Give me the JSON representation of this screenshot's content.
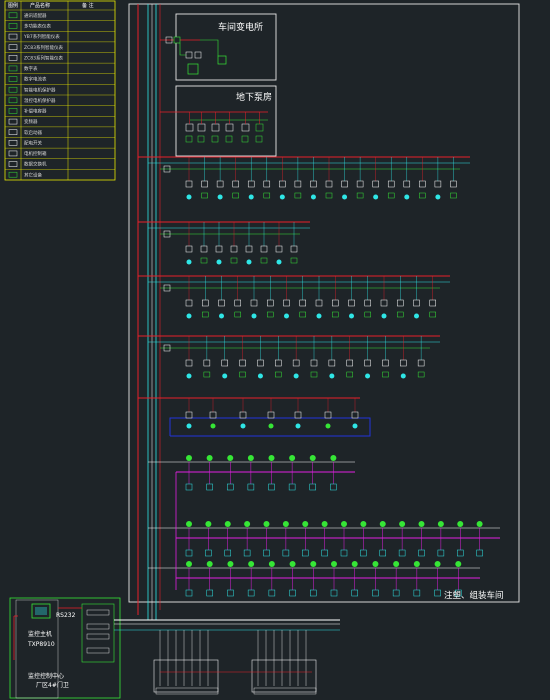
{
  "legend": {
    "headers": [
      "图例",
      "产品名称",
      "备  注"
    ],
    "items": [
      {
        "icon": "green-box-icon",
        "label": "通讯适配器"
      },
      {
        "icon": "green-box-icon",
        "label": "多功能表仪表"
      },
      {
        "icon": "small-box-icon",
        "label": "YB7系列智能仪表"
      },
      {
        "icon": "small-box-icon",
        "label": "ZC83系列智能仪表"
      },
      {
        "icon": "small-box-icon",
        "label": "ZC83系列智能仪表"
      },
      {
        "icon": "green-box-icon",
        "label": "数字表"
      },
      {
        "icon": "green-box-icon",
        "label": "数字电流表"
      },
      {
        "icon": "green-box-icon",
        "label": "智能电机保护器"
      },
      {
        "icon": "green-box-icon",
        "label": "温控电机保护器"
      },
      {
        "icon": "green-box-icon",
        "label": "补偿电容器"
      },
      {
        "icon": "box-icon",
        "label": "变频器"
      },
      {
        "icon": "box-icon",
        "label": "软启动器"
      },
      {
        "icon": "box-icon",
        "label": "配电开关"
      },
      {
        "icon": "box-icon",
        "label": "电机控制箱"
      },
      {
        "icon": "network-icon",
        "label": "数据交换机"
      },
      {
        "icon": "green-box-icon",
        "label": "其它设备"
      }
    ]
  },
  "zones": {
    "substation": "车间变电所",
    "pump_room": "地下泵房",
    "workshop": "注塑、组装车间"
  },
  "control_center": {
    "interface": "RS232",
    "monitor_label": "监控主机",
    "device": "TXP8910",
    "center": "监控控制中心",
    "room": "厂区4#门卫"
  },
  "colors": {
    "background": "#1e2428",
    "bus_red": "#e8202a",
    "bus_cyan": "#2fe6e6",
    "bus_blue": "#2233dd",
    "bus_magenta": "#e020e0",
    "device_green": "#36e636",
    "frame_white": "#e8e8e8",
    "legend_yellow": "#e6e600"
  }
}
